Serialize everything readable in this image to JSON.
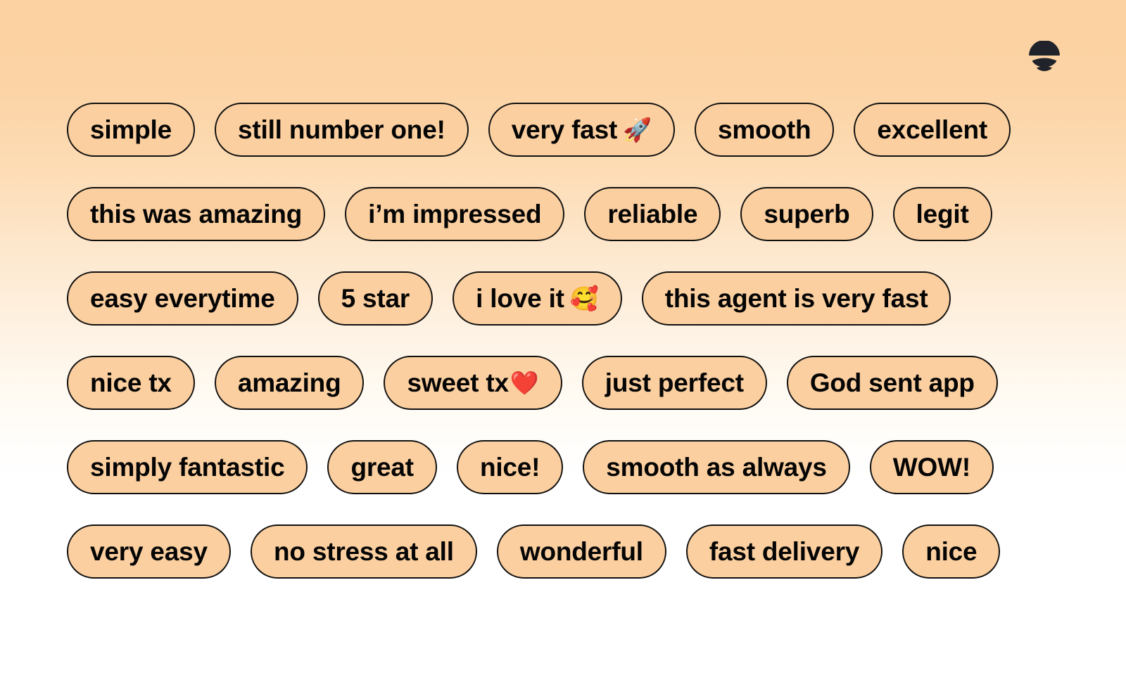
{
  "brand": {
    "logo_name": "stacked-arcs-logo",
    "logo_color": "#20242a"
  },
  "theme": {
    "background_top": "#fcd2a2",
    "background_bottom": "#ffffff",
    "pill_fill": "#fbcf9f",
    "pill_border": "#101010",
    "text_color": "#050505"
  },
  "tags": {
    "rows": [
      {
        "items": [
          {
            "label": "simple",
            "emoji": ""
          },
          {
            "label": "still number one!",
            "emoji": ""
          },
          {
            "label": "very fast",
            "emoji": "🚀"
          },
          {
            "label": "smooth",
            "emoji": ""
          },
          {
            "label": "excellent",
            "emoji": ""
          }
        ]
      },
      {
        "items": [
          {
            "label": "this was amazing",
            "emoji": ""
          },
          {
            "label": "i’m impressed",
            "emoji": ""
          },
          {
            "label": "reliable",
            "emoji": ""
          },
          {
            "label": "superb",
            "emoji": ""
          },
          {
            "label": "legit",
            "emoji": ""
          }
        ]
      },
      {
        "items": [
          {
            "label": "easy everytime",
            "emoji": ""
          },
          {
            "label": "5 star",
            "emoji": ""
          },
          {
            "label": "i love it",
            "emoji": "🥰"
          },
          {
            "label": "this agent is very fast",
            "emoji": ""
          }
        ]
      },
      {
        "items": [
          {
            "label": "nice tx",
            "emoji": ""
          },
          {
            "label": "amazing",
            "emoji": ""
          },
          {
            "label": "sweet tx",
            "emoji": "❤️"
          },
          {
            "label": "just perfect",
            "emoji": ""
          },
          {
            "label": "God sent app",
            "emoji": ""
          }
        ]
      },
      {
        "items": [
          {
            "label": "simply fantastic",
            "emoji": ""
          },
          {
            "label": "great",
            "emoji": ""
          },
          {
            "label": "nice!",
            "emoji": ""
          },
          {
            "label": "smooth as always",
            "emoji": ""
          },
          {
            "label": "WOW!",
            "emoji": ""
          }
        ]
      },
      {
        "items": [
          {
            "label": "very easy",
            "emoji": ""
          },
          {
            "label": "no stress at all",
            "emoji": ""
          },
          {
            "label": "wonderful",
            "emoji": ""
          },
          {
            "label": "fast delivery",
            "emoji": ""
          },
          {
            "label": "nice",
            "emoji": ""
          }
        ]
      }
    ]
  }
}
